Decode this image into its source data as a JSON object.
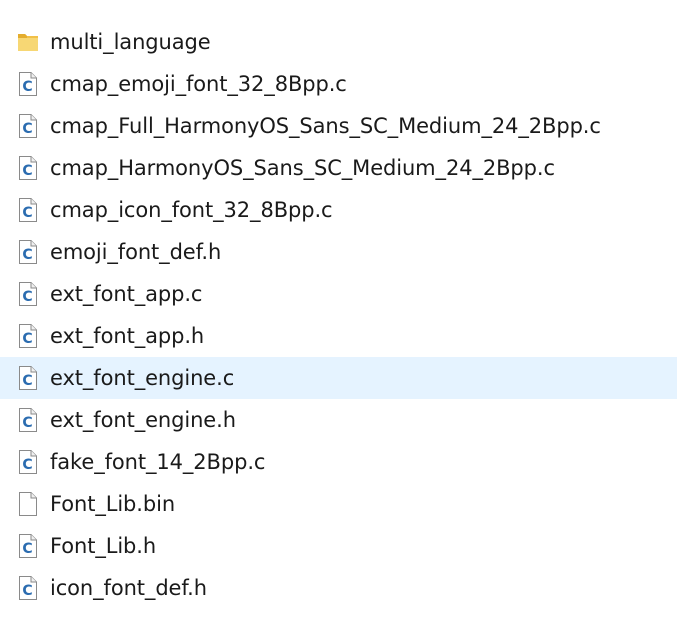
{
  "files": [
    {
      "name": "multi_language",
      "icon": "folder-icon",
      "selected": false
    },
    {
      "name": "cmap_emoji_font_32_8Bpp.c",
      "icon": "c-source-file-icon",
      "selected": false
    },
    {
      "name": "cmap_Full_HarmonyOS_Sans_SC_Medium_24_2Bpp.c",
      "icon": "c-source-file-icon",
      "selected": false
    },
    {
      "name": "cmap_HarmonyOS_Sans_SC_Medium_24_2Bpp.c",
      "icon": "c-source-file-icon",
      "selected": false
    },
    {
      "name": "cmap_icon_font_32_8Bpp.c",
      "icon": "c-source-file-icon",
      "selected": false
    },
    {
      "name": "emoji_font_def.h",
      "icon": "c-source-file-icon",
      "selected": false
    },
    {
      "name": "ext_font_app.c",
      "icon": "c-source-file-icon",
      "selected": false
    },
    {
      "name": "ext_font_app.h",
      "icon": "c-source-file-icon",
      "selected": false
    },
    {
      "name": "ext_font_engine.c",
      "icon": "c-source-file-icon",
      "selected": true
    },
    {
      "name": "ext_font_engine.h",
      "icon": "c-source-file-icon",
      "selected": false
    },
    {
      "name": "fake_font_14_2Bpp.c",
      "icon": "c-source-file-icon",
      "selected": false
    },
    {
      "name": "Font_Lib.bin",
      "icon": "blank-file-icon",
      "selected": false
    },
    {
      "name": "Font_Lib.h",
      "icon": "c-source-file-icon",
      "selected": false
    },
    {
      "name": "icon_font_def.h",
      "icon": "c-source-file-icon",
      "selected": false
    }
  ],
  "colors": {
    "selection": "#e5f3ff",
    "folder": "#f3c94b",
    "c_letter": "#2b6cb0",
    "text": "#1a1a1a"
  }
}
